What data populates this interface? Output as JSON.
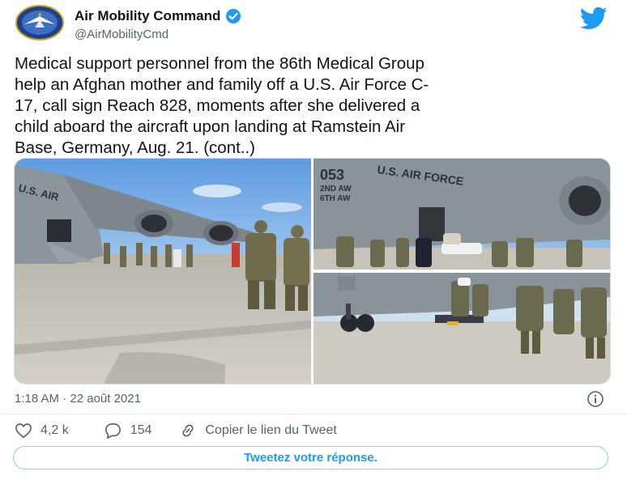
{
  "author": {
    "name": "Air Mobility Command",
    "handle": "@AirMobilityCmd",
    "verified": true,
    "avatar_icon": "air-mobility-command-seal"
  },
  "tweet": {
    "text": "Medical support personnel from the 86th Medical Group\nhelp an Afghan mother and family off a U.S. Air Force C-\n17, call sign Reach 828, moments after she delivered a\nchild aboard the aircraft upon landing at Ramstein Air\nBase, Germany, Aug. 21. (cont..)",
    "timestamp": "1:18 AM · 22 août 2021"
  },
  "media": {
    "photo_1": {
      "markings": "U.S. AIR"
    },
    "photo_2": {
      "markings_number": "053",
      "markings_text": "U.S. AIR FORCE",
      "markings_line1": "2ND AW",
      "markings_line2": "6TH AW"
    },
    "photo_3": {}
  },
  "actions": {
    "like_count": "4,2 k",
    "reply_count": "154",
    "copy_link_label": "Copier le lien du Tweet"
  },
  "reply_button_label": "Tweetez votre réponse.",
  "colors": {
    "accent": "#1d9bf0",
    "text": "#0f1419",
    "secondary_text": "#536471"
  },
  "icons": [
    "air-mobility-command-seal",
    "verified-badge-icon",
    "twitter-bird-icon",
    "info-icon",
    "heart-icon",
    "reply-icon",
    "link-icon"
  ]
}
